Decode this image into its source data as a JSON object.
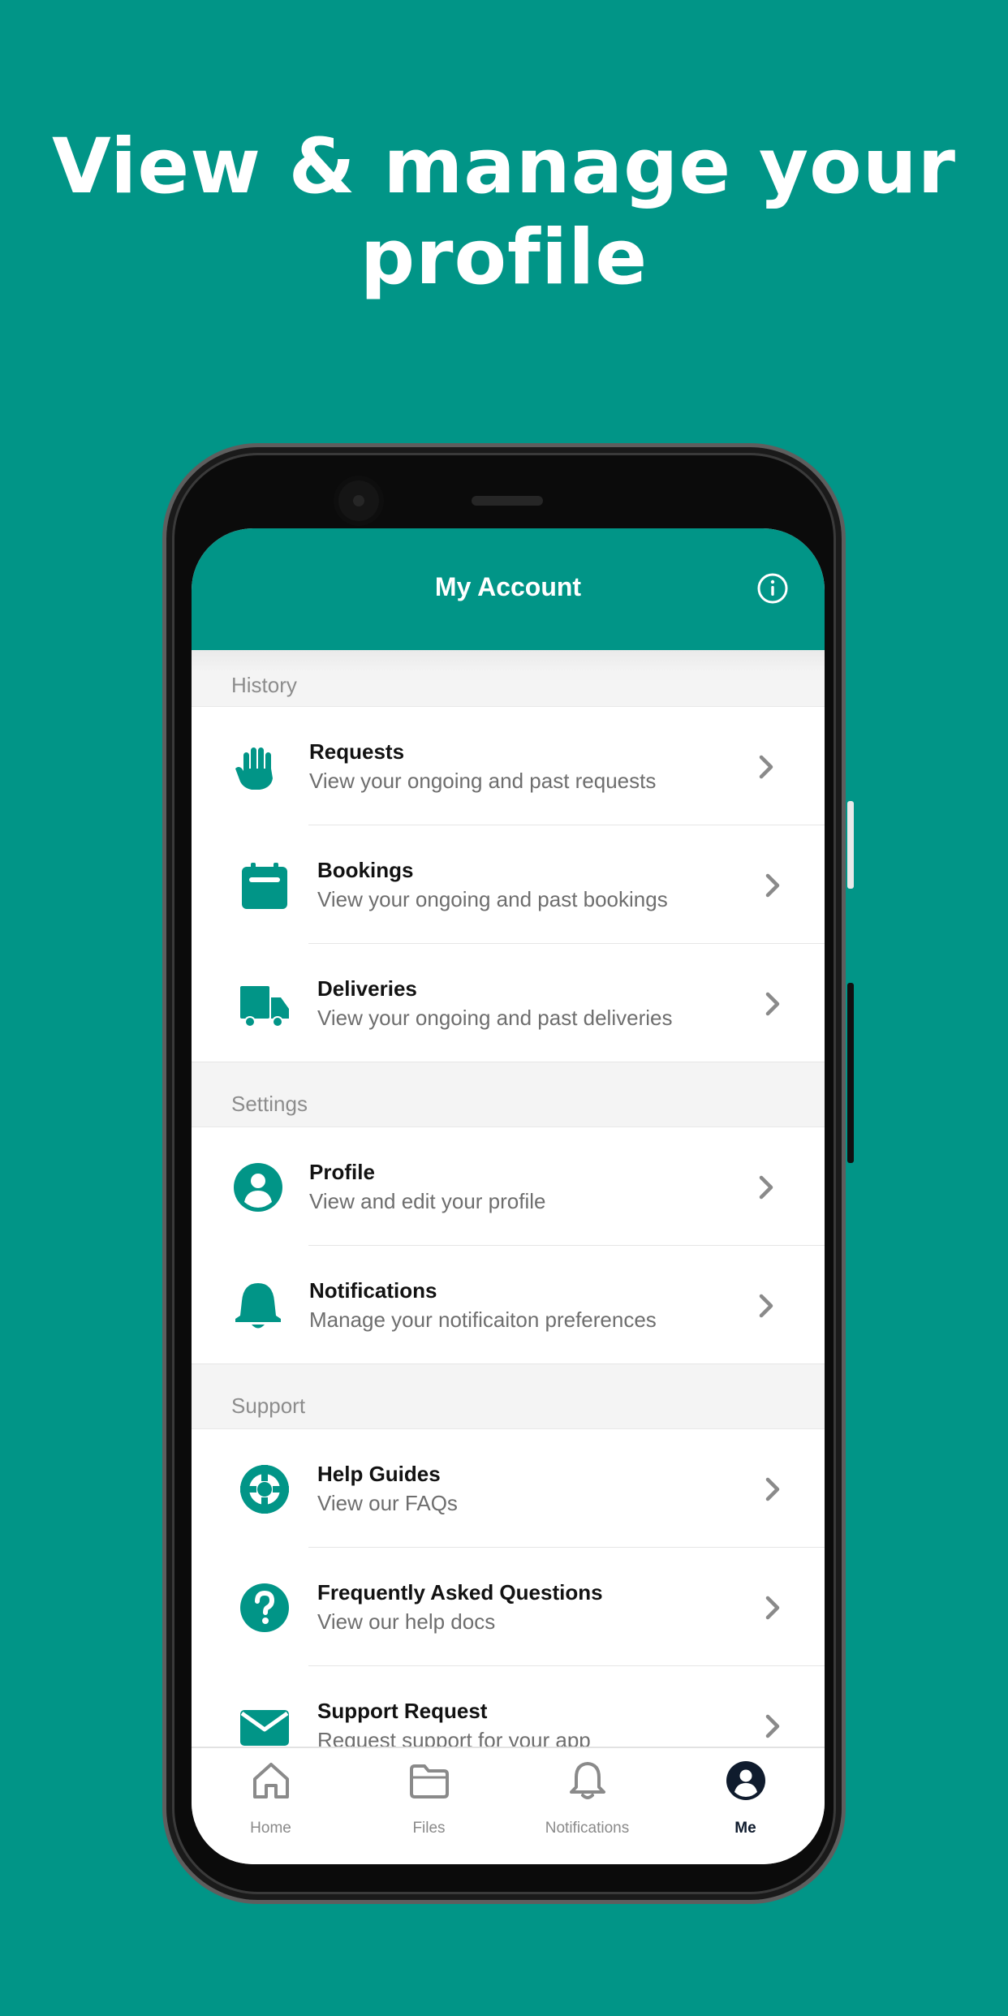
{
  "headline": {
    "line1": "View & manage your",
    "line2": "profile"
  },
  "appbar": {
    "title": "My Account",
    "info_icon": "info-icon"
  },
  "sections": [
    {
      "header": "History",
      "rows": [
        {
          "title": "Requests",
          "subtitle": "View your ongoing and past requests",
          "icon": "hand-icon"
        },
        {
          "title": "Bookings",
          "subtitle": "View your ongoing and past bookings",
          "icon": "calendar-icon"
        },
        {
          "title": "Deliveries",
          "subtitle": "View your ongoing and past deliveries",
          "icon": "truck-icon"
        }
      ]
    },
    {
      "header": "Settings",
      "rows": [
        {
          "title": "Profile",
          "subtitle": "View and edit your profile",
          "icon": "user-circle-icon"
        },
        {
          "title": "Notifications",
          "subtitle": "Manage your notificaiton preferences",
          "icon": "bell-icon"
        }
      ]
    },
    {
      "header": "Support",
      "rows": [
        {
          "title": "Help Guides",
          "subtitle": "View our FAQs",
          "icon": "lifebuoy-icon"
        },
        {
          "title": "Frequently Asked Questions",
          "subtitle": "View our help docs",
          "icon": "question-icon"
        },
        {
          "title": "Support Request",
          "subtitle": "Request support for your app",
          "icon": "envelope-icon"
        }
      ]
    }
  ],
  "tabbar": [
    {
      "label": "Home",
      "icon": "home-icon",
      "active": false
    },
    {
      "label": "Files",
      "icon": "folder-icon",
      "active": false
    },
    {
      "label": "Notifications",
      "icon": "bell-icon",
      "active": false
    },
    {
      "label": "Me",
      "icon": "user-circle-icon",
      "active": true
    }
  ],
  "colors": {
    "brand": "#019587",
    "tab_active": "#0f1b2d",
    "tab_inactive": "#8a8a8a"
  }
}
